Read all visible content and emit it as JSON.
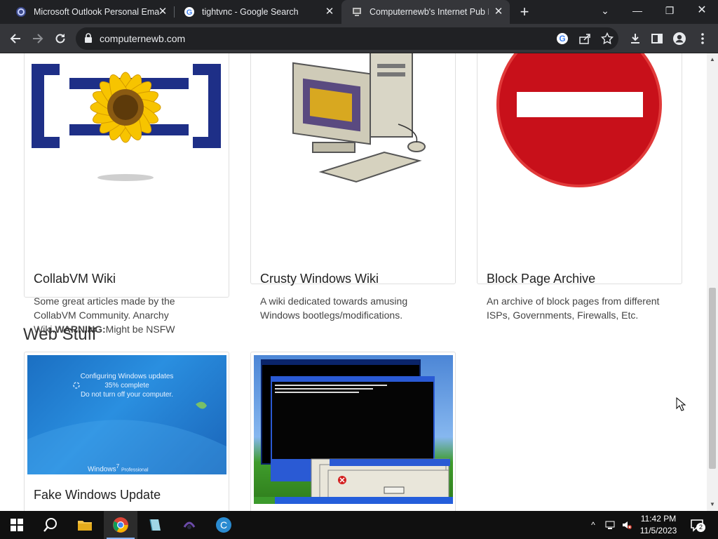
{
  "browser": {
    "tabs": [
      {
        "title": "Microsoft Outlook Personal Ema",
        "icon": "outlook-icon",
        "active": false
      },
      {
        "title": "tightvnc - Google Search",
        "icon": "google-icon",
        "active": false
      },
      {
        "title": "Computernewb's Internet Pub H",
        "icon": "computernewb-icon",
        "active": true
      }
    ],
    "url": "computernewb.com"
  },
  "page": {
    "cards_top": [
      {
        "title": "CollabVM Wiki",
        "desc": "Some great articles made by the CollabVM Community. Anarchy Wiki.",
        "warning_label": "WARNING:",
        "warning_text": "Might be NSFW",
        "image": "sunflower-logo"
      },
      {
        "title": "Crusty Windows Wiki",
        "desc": "A wiki dedicated towards amusing Windows bootlegs/modifications.",
        "image": "retro-computer"
      },
      {
        "title": "Block Page Archive",
        "desc": "An archive of block pages from different ISPs, Governments, Firewalls, Etc.",
        "image": "no-entry-sign"
      }
    ],
    "section_title": "Web Stuff",
    "update_screen": {
      "line1": "Configuring Windows updates",
      "line2": "35% complete",
      "line3": "Do not turn off your computer.",
      "brand": "Windows",
      "brand_version": "7",
      "brand_edition": "Professional"
    },
    "cards_bottom": [
      {
        "title": "Fake Windows Update",
        "image": "windows-update-screenshot"
      },
      {
        "title": "",
        "image": "xp-error-screenshot"
      }
    ]
  },
  "taskbar": {
    "time": "11:42 PM",
    "date": "11/5/2023",
    "notification_count": "2"
  }
}
